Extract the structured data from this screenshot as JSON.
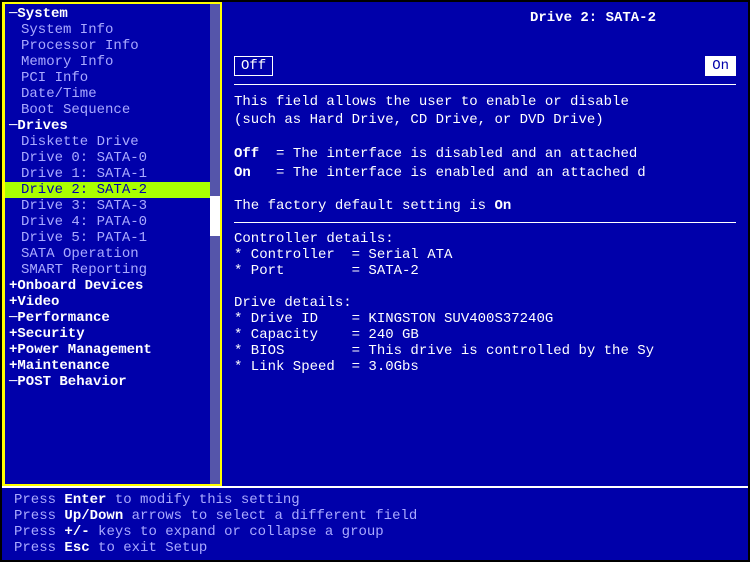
{
  "sidebar": {
    "groups": [
      {
        "label": "System",
        "prefix": "─",
        "expanded": true,
        "items": [
          {
            "label": "System Info"
          },
          {
            "label": "Processor Info"
          },
          {
            "label": "Memory Info"
          },
          {
            "label": "PCI Info"
          },
          {
            "label": "Date/Time"
          },
          {
            "label": "Boot Sequence"
          }
        ]
      },
      {
        "label": "Drives",
        "prefix": "─",
        "expanded": true,
        "items": [
          {
            "label": "Diskette Drive"
          },
          {
            "label": "Drive 0: SATA-0"
          },
          {
            "label": "Drive 1: SATA-1"
          },
          {
            "label": "Drive 2: SATA-2",
            "selected": true
          },
          {
            "label": "Drive 3: SATA-3"
          },
          {
            "label": "Drive 4: PATA-0"
          },
          {
            "label": "Drive 5: PATA-1"
          },
          {
            "label": "SATA Operation"
          },
          {
            "label": "SMART Reporting"
          }
        ]
      },
      {
        "label": "Onboard Devices",
        "prefix": "+",
        "expanded": false
      },
      {
        "label": "Video",
        "prefix": "+",
        "expanded": false
      },
      {
        "label": "Performance",
        "prefix": "─",
        "expanded": false
      },
      {
        "label": "Security",
        "prefix": "+",
        "expanded": false
      },
      {
        "label": "Power Management",
        "prefix": "+",
        "expanded": false
      },
      {
        "label": "Maintenance",
        "prefix": "+",
        "expanded": false
      },
      {
        "label": "POST Behavior",
        "prefix": "─",
        "expanded": false
      }
    ]
  },
  "content": {
    "title": "Drive 2: SATA-2",
    "option_off": "Off",
    "option_on": "On",
    "desc1": "This field allows the user to enable or disable",
    "desc2": "(such as Hard Drive, CD Drive, or DVD Drive)",
    "off_label": "Off",
    "off_desc": "= The interface is disabled and an attached",
    "on_label": "On",
    "on_desc": "= The interface is enabled and an attached d",
    "default_text": "The factory default setting is",
    "default_value": "On",
    "controller_heading": "Controller details:",
    "controller_lines": [
      {
        "key": "* Controller",
        "value": "= Serial ATA"
      },
      {
        "key": "* Port",
        "value": "= SATA-2"
      }
    ],
    "drive_heading": "Drive details:",
    "drive_lines": [
      {
        "key": "* Drive ID",
        "value": "= KINGSTON SUV400S37240G"
      },
      {
        "key": "* Capacity",
        "value": "= 240 GB"
      },
      {
        "key": "* BIOS",
        "value": "= This drive is controlled by the Sy"
      },
      {
        "key": "* Link Speed",
        "value": "= 3.0Gbs"
      }
    ]
  },
  "footer": {
    "lines": [
      {
        "prefix": "Press ",
        "key": "Enter",
        "suffix": " to modify this setting"
      },
      {
        "prefix": "Press ",
        "key": "Up/Down",
        "suffix": " arrows to select a different field"
      },
      {
        "prefix": "Press ",
        "key": "+/-",
        "suffix": " keys to expand or collapse a group"
      },
      {
        "prefix": "Press ",
        "key": "Esc",
        "suffix": " to exit Setup"
      }
    ]
  }
}
